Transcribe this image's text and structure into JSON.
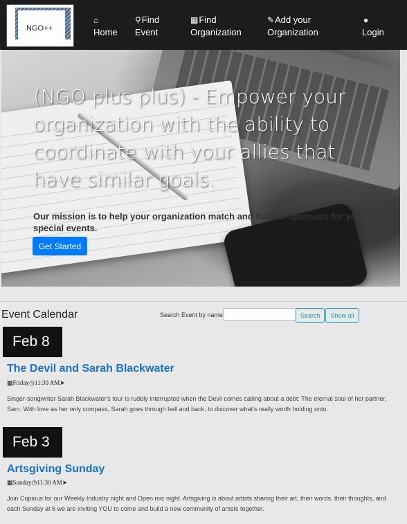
{
  "brand": {
    "name": "NGO++"
  },
  "nav": {
    "home": {
      "icon": "home-icon",
      "glyph": "⌂",
      "label": "Home"
    },
    "find_event": {
      "icon": "search-icon",
      "glyph": "⚲",
      "label_1": "Find",
      "label_2": "Event"
    },
    "find_org": {
      "icon": "building-icon",
      "glyph": "▦",
      "label_1": "Find",
      "label_2": "Organization"
    },
    "add_org": {
      "icon": "edit-icon",
      "glyph": "✎",
      "label_1": "Add your",
      "label_2": "Organization"
    },
    "login": {
      "icon": "user-icon",
      "glyph": "●",
      "label": "Login"
    }
  },
  "hero": {
    "headline": "(NGO plus plus) - Empower your organization with the ability to coordinate with your allies that have similar goals.",
    "mission": "Our mission is to help your organization match and find co-sponsors for your special events.",
    "cta_label": "Get Started"
  },
  "calendar": {
    "title": "Event Calendar",
    "search_label": "Search Event by name",
    "search_value": "",
    "search_button": "Search",
    "show_all_button": "Show all",
    "events": [
      {
        "date": "Feb 8",
        "title": "The Devil and Sarah Blackwater",
        "day": "Friday",
        "time": "11:30 AM",
        "description": "Singer-songwriter Sarah Blackwater's tour is rudely interrupted when the Devil comes calling about a debt: The eternal soul of her partner, Sam. With love as her only compass, Sarah goes through hell and back, to discover what's really worth holding onto."
      },
      {
        "date": "Feb 3",
        "title": "Artsgiving Sunday",
        "day": "Sunday",
        "time": "11:30 AM",
        "description": "Join Copious for our Weekly Industry night and Open mic night. Artsgiving is about artists sharing their art, their words, their thoughts, and each Sunday at 6 we are inviting YOU to come and build a new community of artists together."
      }
    ]
  },
  "colors": {
    "navbar": "#1c1c1c",
    "primary": "#007bff",
    "link": "#1a73c6",
    "outline": "#17a2b8"
  }
}
